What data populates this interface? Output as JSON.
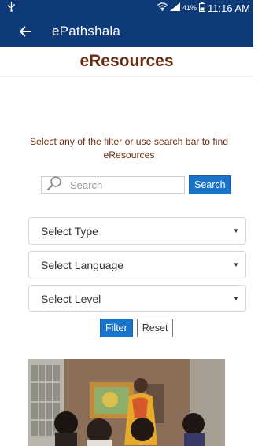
{
  "status_bar": {
    "usb_icon": "usb-icon",
    "wifi_icon": "wifi-icon",
    "signal_icon": "signal-icon",
    "battery_percent": "41%",
    "battery_icon": "battery-icon",
    "time": "11:16 AM"
  },
  "app_bar": {
    "title": "ePathshala",
    "back_icon": "arrow-left-icon"
  },
  "page": {
    "title": "eResources"
  },
  "instruction": "Select any of the filter or use search bar to find eResources",
  "search": {
    "placeholder": "Search",
    "button_label": "Search",
    "icon": "magnifier-icon"
  },
  "filters": {
    "type_label": "Select Type",
    "language_label": "Select Language",
    "level_label": "Select Level",
    "arrow": "▼"
  },
  "actions": {
    "filter_label": "Filter",
    "reset_label": "Reset"
  },
  "colors": {
    "app_bar": "#0f3a78",
    "title_brown": "#6b2d12",
    "button_blue": "#1a73c9"
  }
}
